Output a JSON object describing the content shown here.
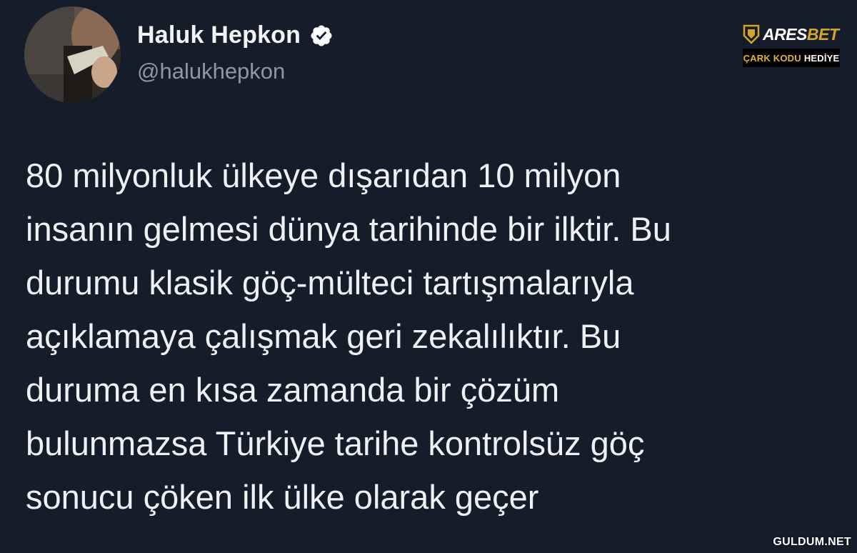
{
  "author": {
    "display_name": "Haluk Hepkon",
    "handle": "@halukhepkon",
    "verified_icon": "verified-badge-icon",
    "avatar_icon": "profile-avatar"
  },
  "ad_brand": {
    "name_part1": "ARES",
    "name_part2": "BET",
    "badge_part1": "ÇARK KODU",
    "badge_part2": "HEDİYE",
    "accent_color": "#d4a32a"
  },
  "tweet": {
    "lines": [
      "80 milyonluk ülkeye dışarıdan 10 milyon",
      "insanın gelmesi dünya tarihinde bir ilktir. Bu",
      "durumu klasik göç-mülteci tartışmalarıyla",
      "açıklamaya çalışmak geri zekalılıktır. Bu",
      "duruma en kısa zamanda bir çözüm",
      "bulunmazsa Türkiye tarihe kontrolsüz göç",
      "sonucu çöken ilk ülke olarak geçer"
    ]
  },
  "watermark": "GULDUM.NET",
  "colors": {
    "background": "#151d2a",
    "text": "#eef1f4",
    "muted": "#8b98a5",
    "verified": "#ffffff"
  }
}
